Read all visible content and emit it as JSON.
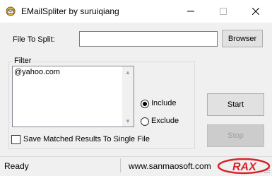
{
  "window": {
    "title": "EMailSpliter by suruiqiang"
  },
  "form": {
    "file_label": "File To Split:",
    "file_value": "",
    "browser_label": "Browser",
    "filter_label": "Filter",
    "filter_text": "@yahoo.com",
    "include_label": "Include",
    "exclude_label": "Exclude",
    "include_selected": true,
    "save_single_label": "Save Matched Results To Single File",
    "save_single_checked": false,
    "start_label": "Start",
    "stop_label": "Stop"
  },
  "status": {
    "left_text": "Ready",
    "right_text": "www.sanmaosoft.com",
    "logo_text": "RAX"
  },
  "colors": {
    "logo_red": "#d9232a"
  }
}
